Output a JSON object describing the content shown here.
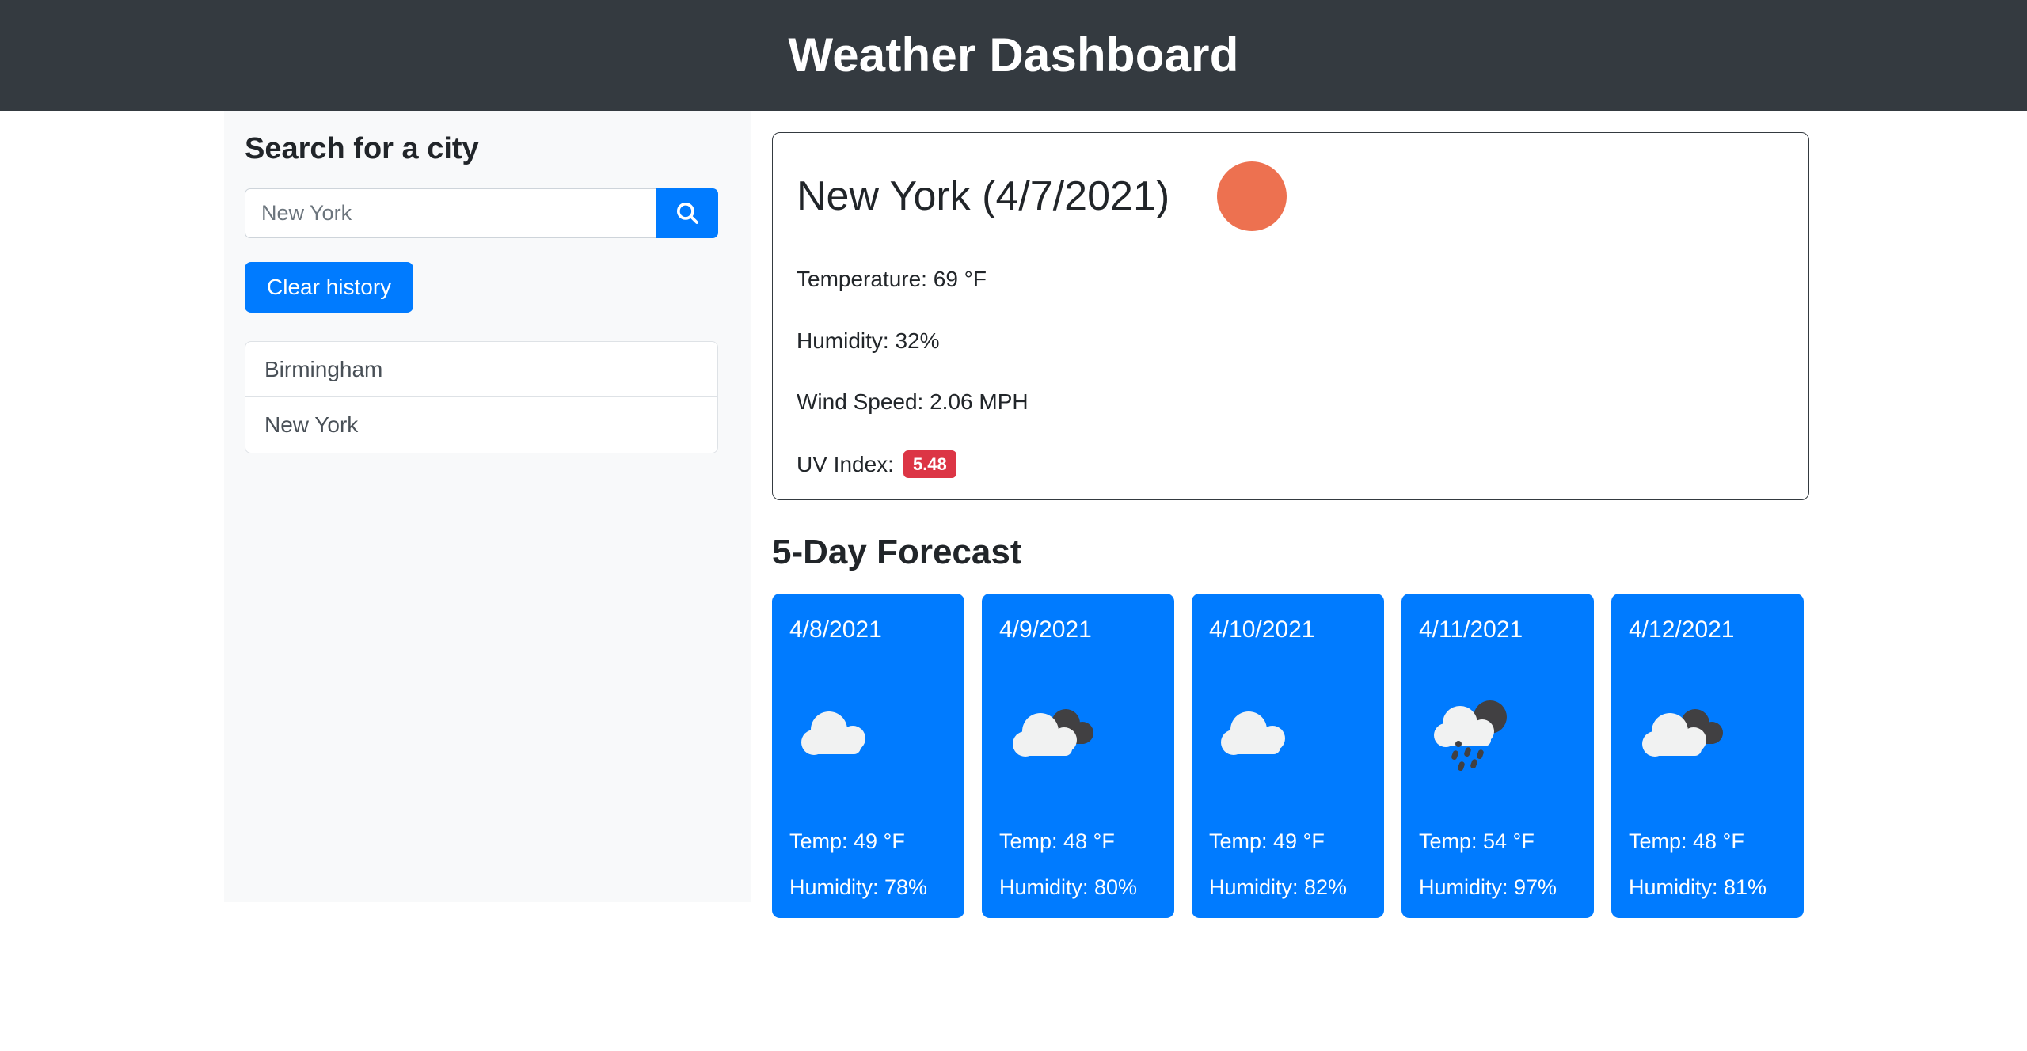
{
  "header": {
    "title": "Weather Dashboard"
  },
  "sidebar": {
    "title": "Search for a city",
    "search": {
      "placeholder": "New York",
      "value": "",
      "icon": "search-icon",
      "button_label": ""
    },
    "clear_history_label": "Clear history",
    "history": [
      {
        "label": "Birmingham"
      },
      {
        "label": "New York"
      }
    ]
  },
  "current": {
    "city_with_date": "New York (4/7/2021)",
    "icon": "sun-clear-icon",
    "icon_color": "#ed7150",
    "temperature": "Temperature: 69 °F",
    "humidity": "Humidity: 32%",
    "wind_speed": "Wind Speed: 2.06 MPH",
    "uv_label": "UV Index:",
    "uv_value": "5.48",
    "uv_badge_color": "#dc3545"
  },
  "forecast": {
    "title": "5-Day Forecast",
    "card_color": "#007bff",
    "days": [
      {
        "date": "4/8/2021",
        "icon": "cloud-icon",
        "temp": "Temp: 49 °F",
        "humidity": "Humidity: 78%"
      },
      {
        "date": "4/9/2021",
        "icon": "broken-clouds-icon",
        "temp": "Temp: 48 °F",
        "humidity": "Humidity: 80%"
      },
      {
        "date": "4/10/2021",
        "icon": "cloud-icon",
        "temp": "Temp: 49 °F",
        "humidity": "Humidity: 82%"
      },
      {
        "date": "4/11/2021",
        "icon": "rain-icon",
        "temp": "Temp: 54 °F",
        "humidity": "Humidity: 97%"
      },
      {
        "date": "4/12/2021",
        "icon": "broken-clouds-icon",
        "temp": "Temp: 48 °F",
        "humidity": "Humidity: 81%"
      }
    ]
  }
}
